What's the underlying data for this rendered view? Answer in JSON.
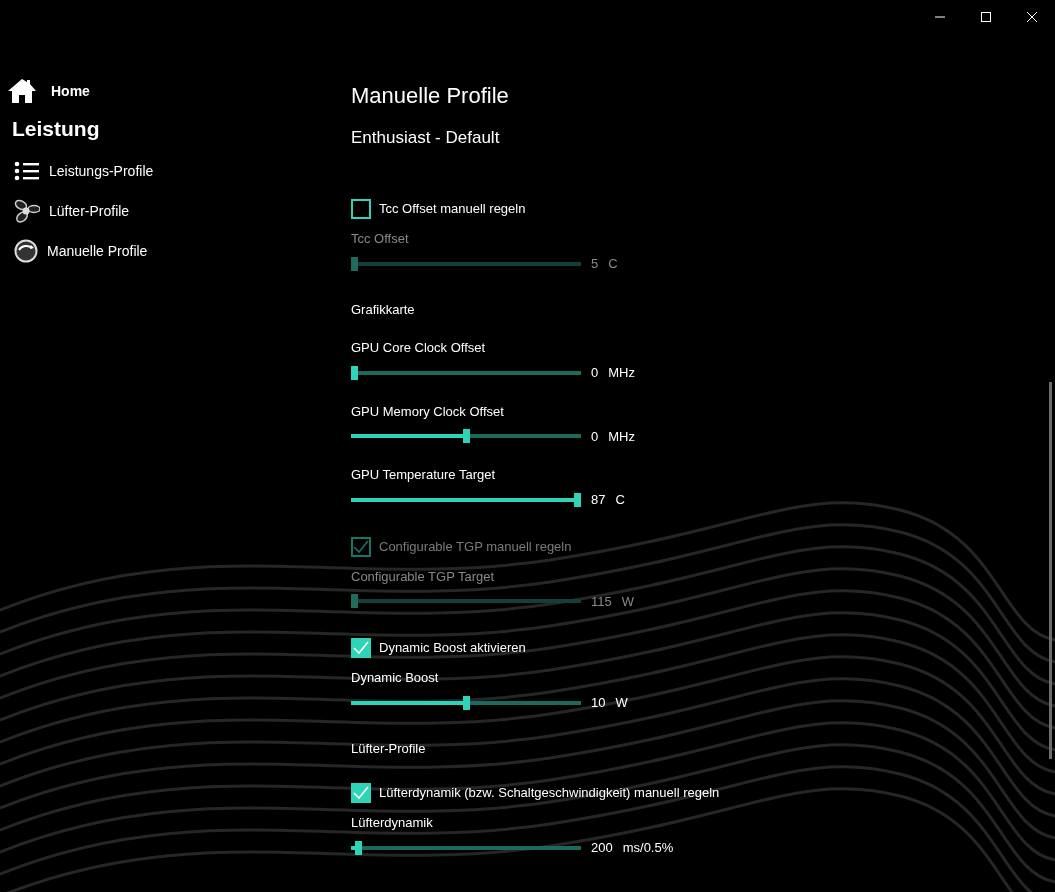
{
  "sidebar": {
    "home": "Home",
    "section": "Leistung",
    "items": [
      {
        "label": "Leistungs-Profile"
      },
      {
        "label": "Lüfter-Profile"
      },
      {
        "label": "Manuelle Profile"
      }
    ]
  },
  "page": {
    "title": "Manuelle Profile",
    "subtitle": "Enthusiast - Default"
  },
  "settings": [
    {
      "kind": "checkbox",
      "label": "Tcc Offset manuell regeln",
      "checked": false,
      "disabled": false
    },
    {
      "kind": "slider",
      "label": "Tcc Offset",
      "level": 0,
      "value": "5",
      "unit": "C",
      "disabled": true
    },
    {
      "kind": "heading",
      "label": "Grafikkarte"
    },
    {
      "kind": "slider",
      "label": "GPU Core Clock Offset",
      "level": 0,
      "value": "0",
      "unit": "MHz",
      "disabled": false
    },
    {
      "kind": "slider",
      "label": "GPU Memory Clock Offset",
      "level": 0.5,
      "value": "0",
      "unit": "MHz",
      "disabled": false
    },
    {
      "kind": "slider",
      "label": "GPU Temperature Target",
      "level": 1,
      "value": "87",
      "unit": "C",
      "disabled": false
    },
    {
      "kind": "checkbox",
      "label": "Configurable TGP manuell regeln",
      "checked": true,
      "disabled": true
    },
    {
      "kind": "slider",
      "label": "Configurable TGP Target",
      "level": 0,
      "value": "115",
      "unit": "W",
      "disabled": true
    },
    {
      "kind": "checkbox",
      "label": "Dynamic Boost aktivieren",
      "checked": true,
      "disabled": false
    },
    {
      "kind": "slider",
      "label": "Dynamic Boost",
      "level": 0.5,
      "value": "10",
      "unit": "W",
      "disabled": false
    },
    {
      "kind": "heading",
      "label": "Lüfter-Profile"
    },
    {
      "kind": "checkbox",
      "label": "Lüfterdynamik (bzw. Schaltgeschwindigkeit) manuell regeln",
      "checked": true,
      "disabled": false
    },
    {
      "kind": "slider",
      "label": "Lüfterdynamik",
      "level": 0.02,
      "value": "200",
      "unit": "ms/0.5%",
      "disabled": false
    }
  ]
}
